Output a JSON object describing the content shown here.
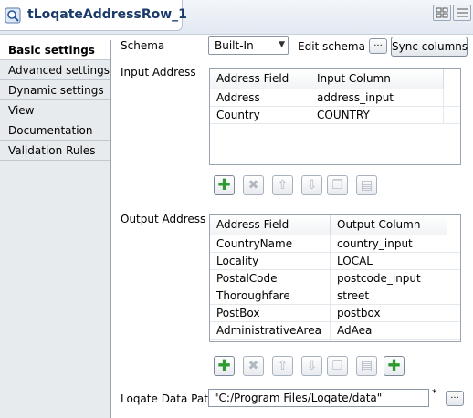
{
  "window": {
    "title": "tLoqateAddressRow_1"
  },
  "sidebar": {
    "items": [
      {
        "label": "Basic settings"
      },
      {
        "label": "Advanced settings"
      },
      {
        "label": "Dynamic settings"
      },
      {
        "label": "View"
      },
      {
        "label": "Documentation"
      },
      {
        "label": "Validation Rules"
      }
    ]
  },
  "schema": {
    "label": "Schema",
    "value": "Built-In",
    "edit_label": "Edit schema",
    "browse_label": "...",
    "sync_label": "Sync columns"
  },
  "input_address": {
    "label": "Input Address",
    "columns": [
      "Address Field",
      "Input Column"
    ],
    "rows": [
      [
        "Address",
        "address_input"
      ],
      [
        "Country",
        "COUNTRY"
      ]
    ]
  },
  "output_address": {
    "label": "Output Address",
    "columns": [
      "Address Field",
      "Output Column"
    ],
    "rows": [
      [
        "CountryName",
        "country_input"
      ],
      [
        "Locality",
        "LOCAL"
      ],
      [
        "PostalCode",
        "postcode_input"
      ],
      [
        "Thoroughfare",
        "street"
      ],
      [
        "PostBox",
        "postbox"
      ],
      [
        "AdministrativeArea",
        "AdAea"
      ]
    ]
  },
  "data_path": {
    "label": "Loqate Data Path",
    "value": "\"C:/Program Files/Loqate/data\"",
    "required_mark": "*",
    "browse_label": "..."
  },
  "icons": {
    "add": "plus-icon",
    "remove": "delete-icon",
    "up": "move-up-icon",
    "down": "move-down-icon",
    "copy": "copy-icon",
    "paste": "paste-icon"
  },
  "colors": {
    "accent": "#2f9a2f",
    "title": "#1a3a6a"
  }
}
